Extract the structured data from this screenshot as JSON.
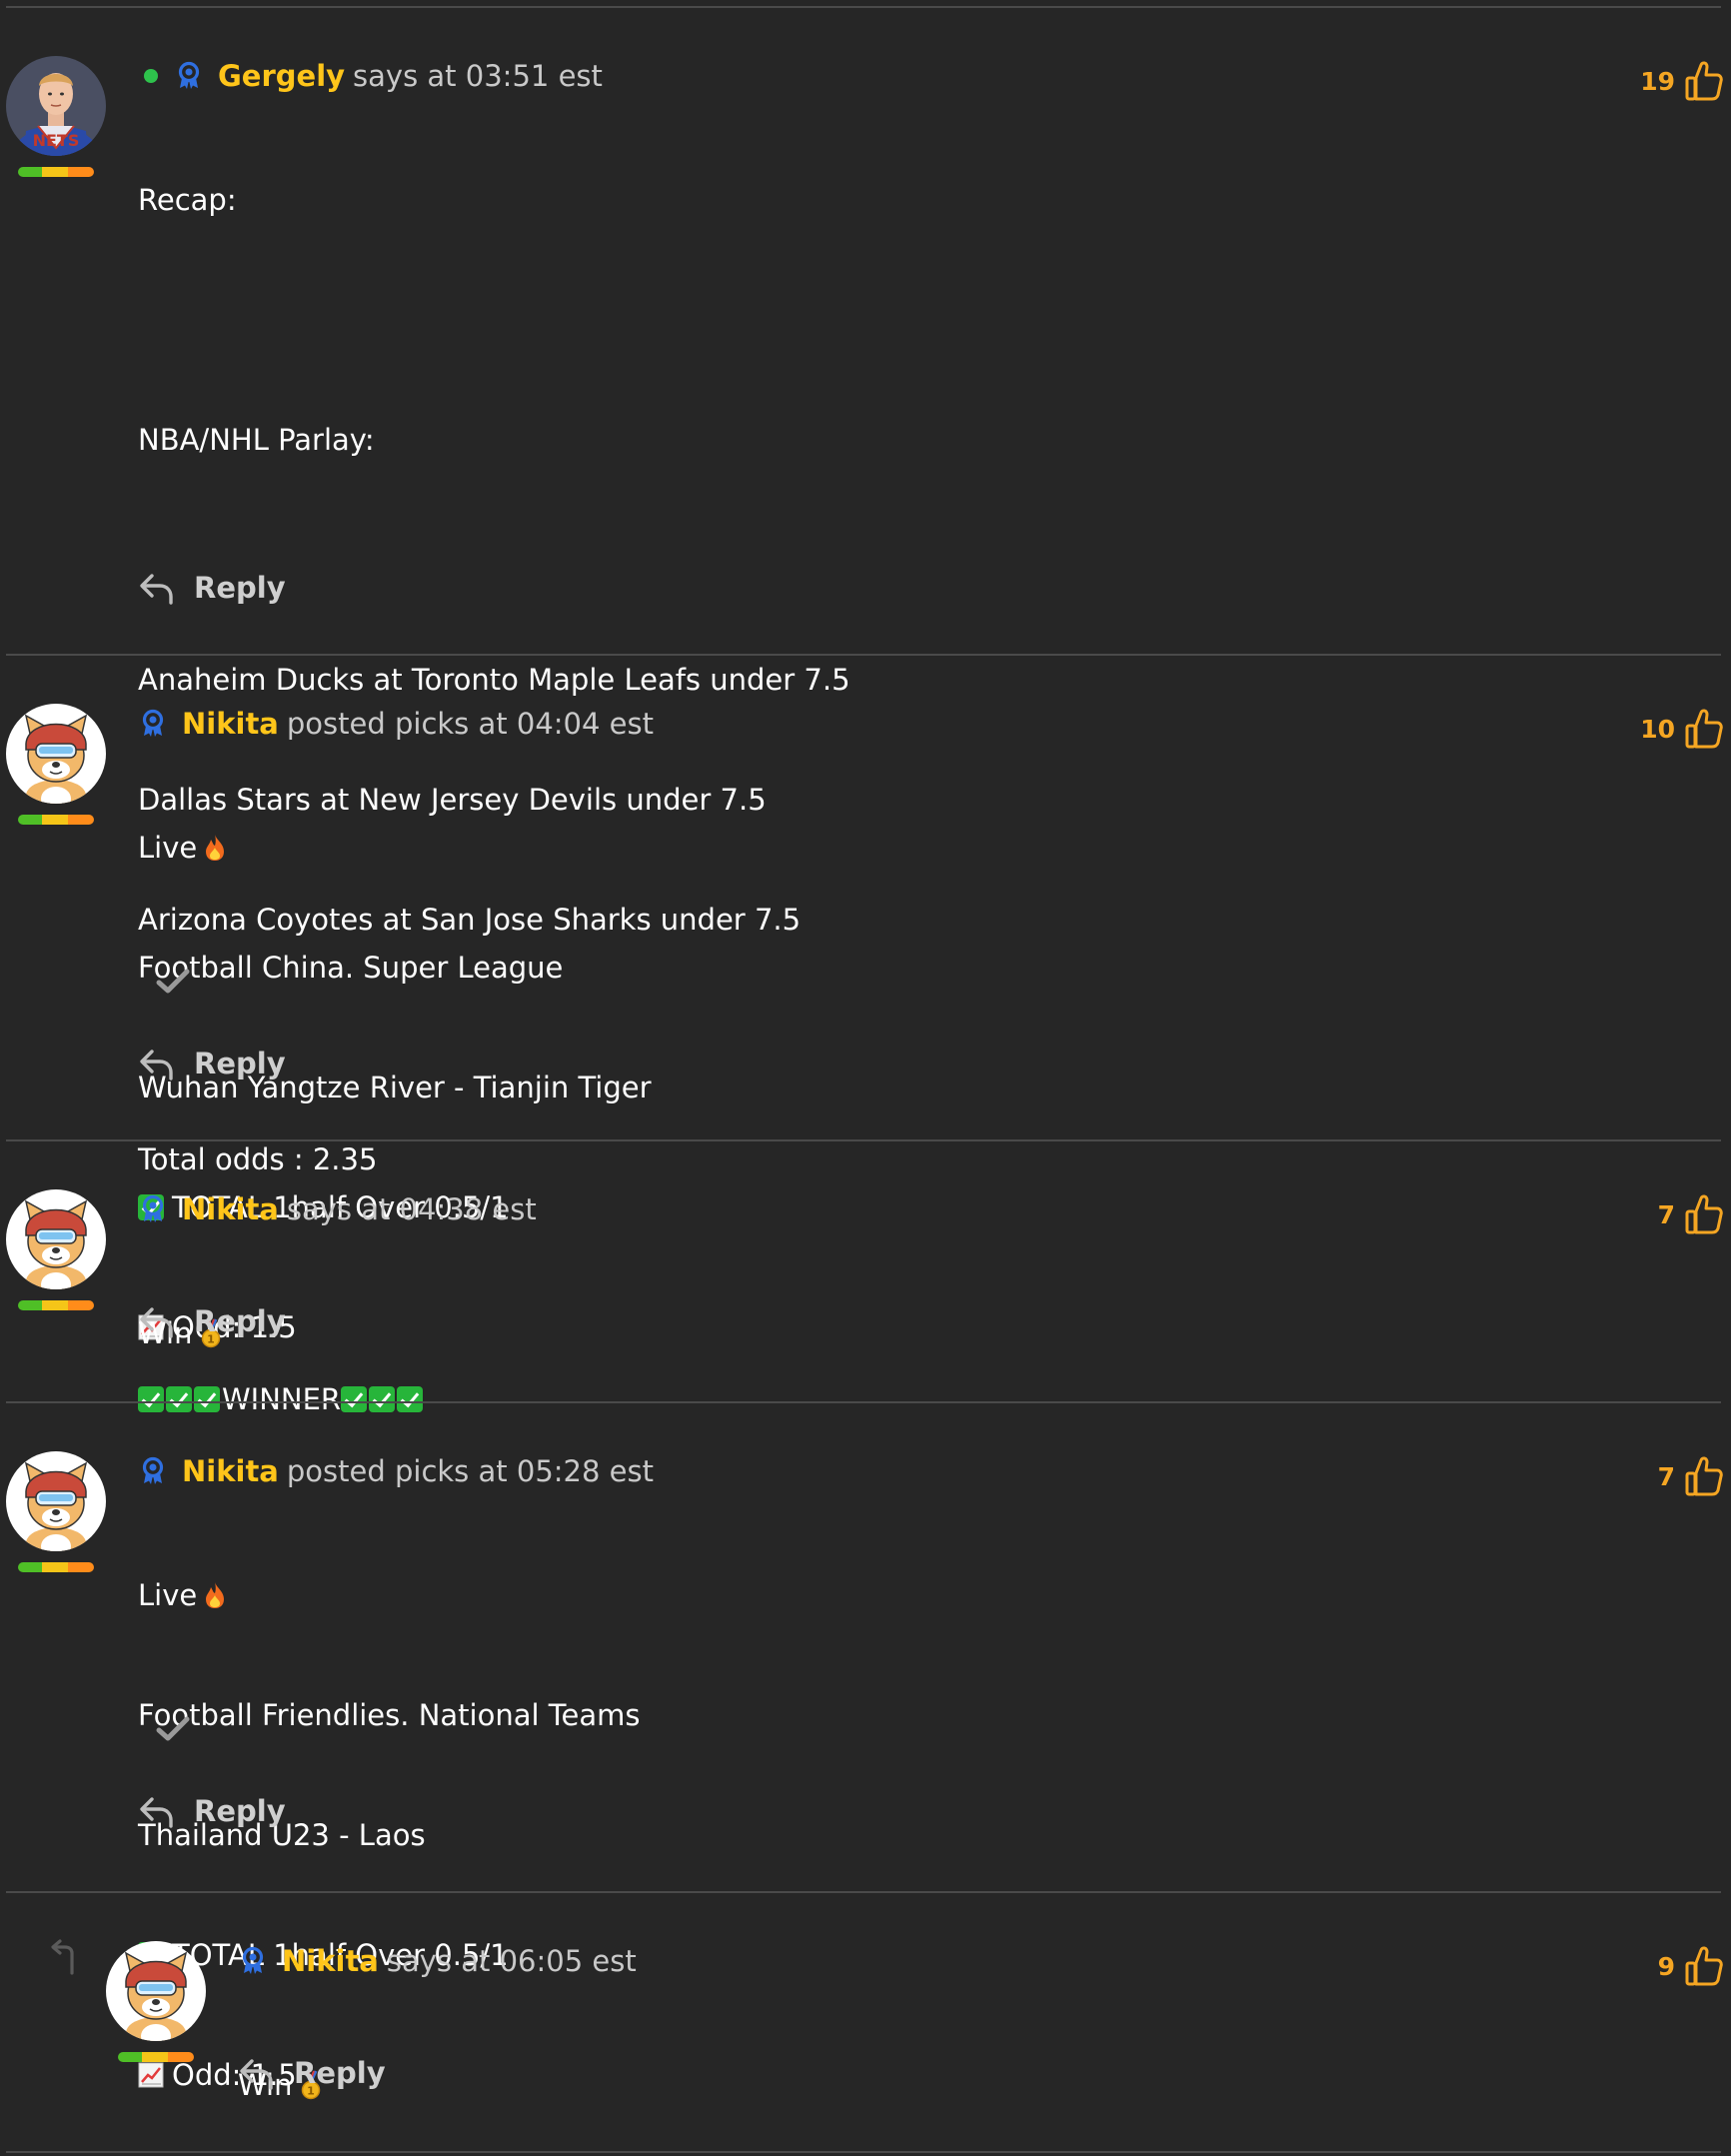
{
  "colors": {
    "background": "#262626",
    "author": "#ffc51a",
    "likes": "#f5a623",
    "online": "#2ec24c"
  },
  "comments": [
    {
      "author": "Gergely",
      "meta": "says at 03:51 est",
      "online": true,
      "likes": "19",
      "lines": [
        "Recap:",
        "",
        "NBA/NHL Parlay:",
        "",
        "Anaheim Ducks at Toronto Maple Leafs under 7.5",
        "Dallas Stars at New Jersey Devils under 7.5",
        "Arizona Coyotes at San Jose Sharks under 7.5",
        "",
        "Total odds : 2.35",
        "",
        "WINNER"
      ],
      "reply_label": "Reply"
    },
    {
      "author": "Nikita",
      "meta": "posted picks at 04:04 est",
      "likes": "10",
      "live_label": "Live",
      "lines": [
        "Football China. Super League",
        "Wuhan Yangtze River - Tianjin Tiger",
        "TOTAL 1half Over 0.5/1",
        "Odd: 1.5"
      ],
      "reply_label": "Reply"
    },
    {
      "author": "Nikita",
      "meta": "says at 04:38 est",
      "likes": "7",
      "text": "Win",
      "reply_label": "Reply"
    },
    {
      "author": "Nikita",
      "meta": "posted picks at 05:28 est",
      "likes": "7",
      "live_label": "Live",
      "lines": [
        "Football Friendlies. National Teams",
        "Thailand U23 - Laos",
        "TOTAL 1half Over 0.5/1",
        "Odd: 1.5"
      ],
      "reply_label": "Reply"
    },
    {
      "author": "Nikita",
      "meta": "says at 06:05 est",
      "likes": "9",
      "text": "Win",
      "reply_label": "Reply"
    }
  ]
}
